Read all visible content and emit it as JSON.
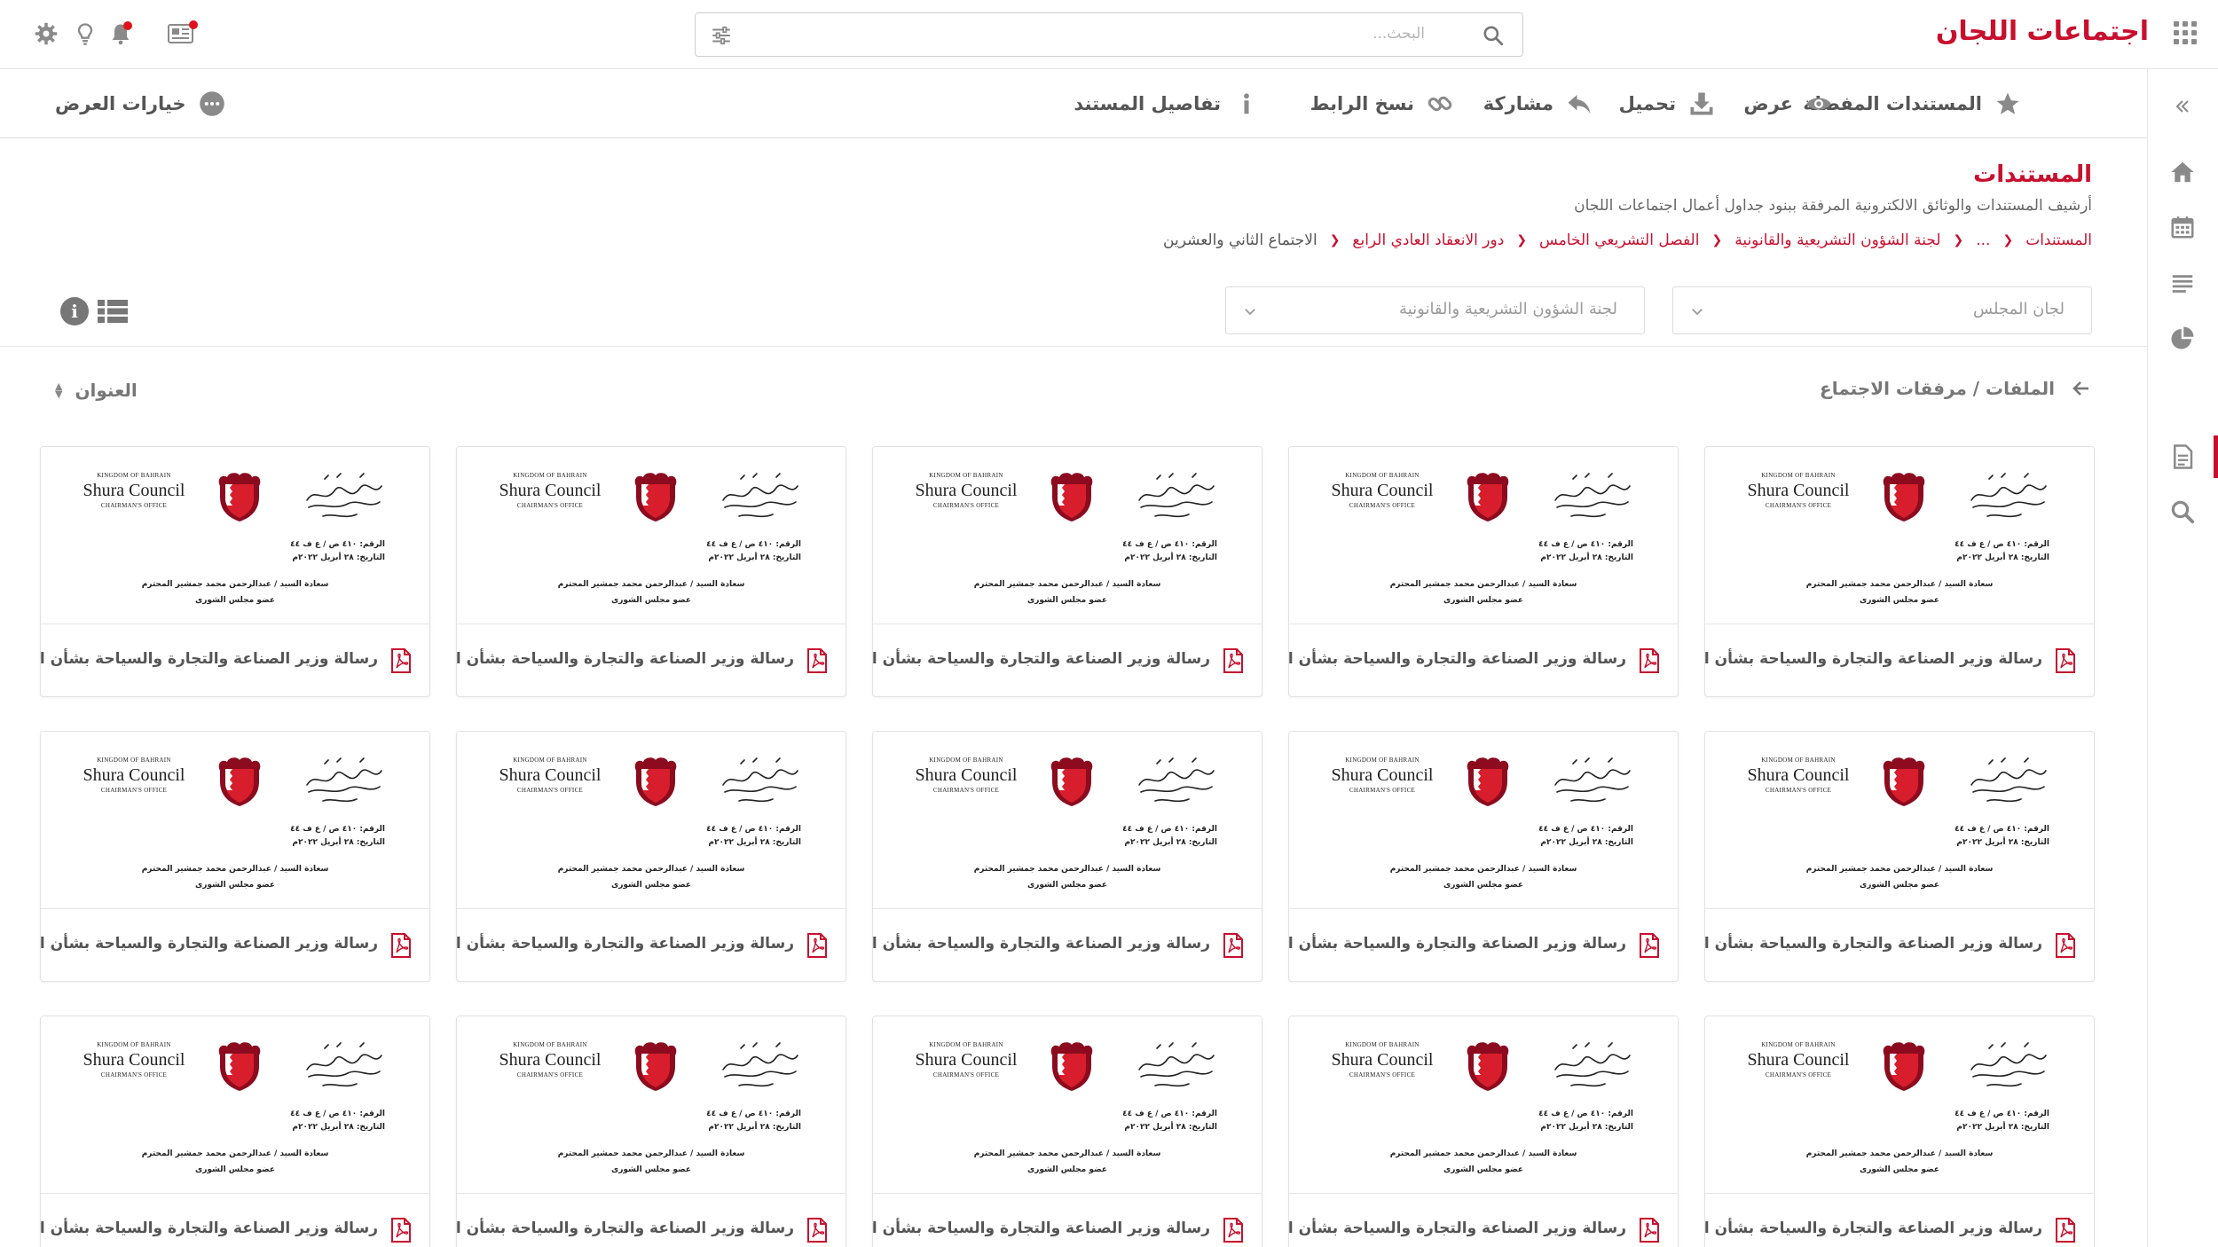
{
  "header": {
    "app_title": "اجتماعات اللجان",
    "search_placeholder": "البحث...",
    "icons": [
      "apps-grid-icon",
      "search-icon",
      "filter-sliders-icon",
      "news-icon",
      "bell-icon",
      "lightbulb-icon",
      "gear-icon"
    ],
    "notification_color": "#e0101c"
  },
  "brand": {
    "accent": "#c8102e"
  },
  "sidebar": {
    "items": [
      {
        "icon": "home-icon"
      },
      {
        "icon": "calendar-icon"
      },
      {
        "icon": "list-icon"
      },
      {
        "icon": "pie-chart-icon"
      },
      {
        "icon": "document-icon",
        "active": true
      },
      {
        "icon": "search-icon"
      }
    ]
  },
  "toolbar": {
    "favorites": "المستندات المفضلة",
    "view": "عرض",
    "download": "تحميل",
    "share": "مشاركة",
    "copy_link": "نسخ الرابط",
    "details": "تفاصيل المستند",
    "view_options": "خيارات العرض"
  },
  "page": {
    "title": "المستندات",
    "description": "أرشيف المستندات والوثائق الالكترونية المرفقة ببنود جداول أعمال اجتماعات اللجان"
  },
  "breadcrumb": {
    "items": [
      "المستندات",
      "...",
      "لجنة الشؤون التشريعية والقانونية",
      "الفصل التشريعي الخامس",
      "دور الانعقاد العادي الرابع"
    ],
    "current": "الاجتماع الثاني والعشرين"
  },
  "filters": {
    "council_committees": "لجان المجلس",
    "committee": "لجنة الشؤون التشريعية والقانونية"
  },
  "section": {
    "path": "الملفات / مرفقات الاجتماع",
    "sort_label": "العنوان"
  },
  "document_preview": {
    "arabic_logo": "مجلس الشورى",
    "kingdom": "KINGDOM OF BAHRAIN",
    "council": "Shura Council",
    "office": "CHAIRMAN'S OFFICE",
    "ref": "الرقم: ٤١٠ ص / ع ف ٤٤",
    "date": "التاريخ: ٢٨ أبريل ٢٠٢٢م",
    "addressee": "سعادة السيد / عبدالرحمن محمد جمشير المحترم",
    "role": "عضو مجلس الشورى"
  },
  "documents": [
    {
      "name": "رسالة وزير الصناعة والتجارة والسياحة بشأن السؤ..."
    },
    {
      "name": "رسالة وزير الصناعة والتجارة والسياحة بشأن السؤ..."
    },
    {
      "name": "رسالة وزير الصناعة والتجارة والسياحة بشأن السؤ..."
    },
    {
      "name": "رسالة وزير الصناعة والتجارة والسياحة بشأن السؤ..."
    },
    {
      "name": "رسالة وزير الصناعة والتجارة والسياحة بشأن السؤ..."
    },
    {
      "name": "رسالة وزير الصناعة والتجارة والسياحة بشأن السؤ..."
    },
    {
      "name": "رسالة وزير الصناعة والتجارة والسياحة بشأن السؤ..."
    },
    {
      "name": "رسالة وزير الصناعة والتجارة والسياحة بشأن السؤ..."
    },
    {
      "name": "رسالة وزير الصناعة والتجارة والسياحة بشأن السؤ..."
    },
    {
      "name": "رسالة وزير الصناعة والتجارة والسياحة بشأن السؤ..."
    },
    {
      "name": "رسالة وزير الصناعة والتجارة والسياحة بشأن السؤ..."
    },
    {
      "name": "رسالة وزير الصناعة والتجارة والسياحة بشأن السؤ..."
    },
    {
      "name": "رسالة وزير الصناعة والتجارة والسياحة بشأن السؤ..."
    },
    {
      "name": "رسالة وزير الصناعة والتجارة والسياحة بشأن السؤ..."
    },
    {
      "name": "رسالة وزير الصناعة والتجارة والسياحة بشأن السؤ..."
    }
  ]
}
